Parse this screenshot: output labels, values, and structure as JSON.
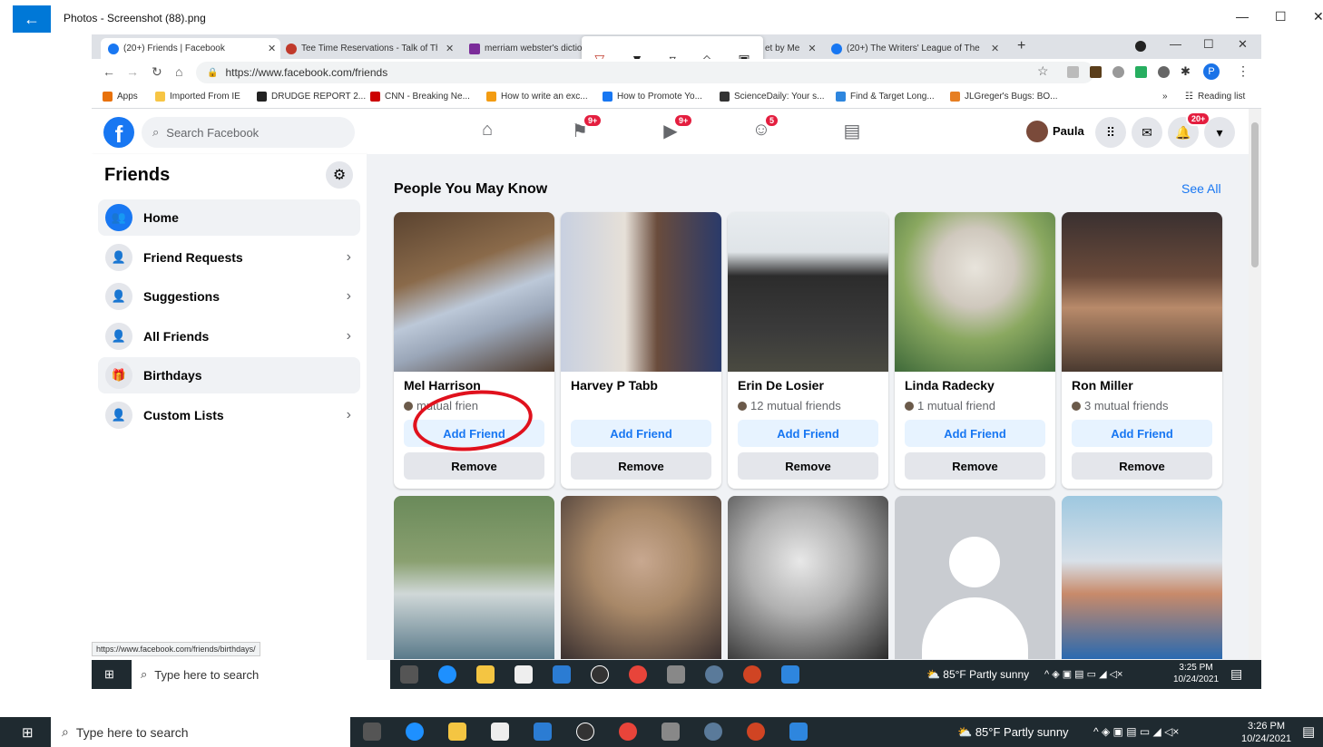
{
  "photos": {
    "title": "Photos - Screenshot (88).png",
    "back_icon": "←",
    "min": "—",
    "max": "☐",
    "close": "✕"
  },
  "tabs": [
    {
      "label": "(20+) Friends | Facebook",
      "color": "#1877f2"
    },
    {
      "label": "Tee Time Reservations - Talk of Th",
      "color": "#c0392b"
    },
    {
      "label": "merriam webster's dictio",
      "color": "#7b2c9a"
    },
    {
      "label": "et by Me",
      "color": "#999999"
    },
    {
      "label": "(20+) The Writers' League of The",
      "color": "#1877f2"
    }
  ],
  "address": {
    "url": "https://www.facebook.com/friends"
  },
  "bookmarks": [
    {
      "label": "Apps",
      "color": "#e8710a"
    },
    {
      "label": "Imported From IE",
      "color": "#f7c544"
    },
    {
      "label": "DRUDGE REPORT 2...",
      "color": "#222222"
    },
    {
      "label": "CNN - Breaking Ne...",
      "color": "#cc0000"
    },
    {
      "label": "How to write an exc...",
      "color": "#f39c12"
    },
    {
      "label": "How to Promote Yo...",
      "color": "#1877f2"
    },
    {
      "label": "ScienceDaily: Your s...",
      "color": "#333333"
    },
    {
      "label": "Find & Target Long...",
      "color": "#2e86de"
    },
    {
      "label": "JLGreger's Bugs: BO...",
      "color": "#e67e22"
    }
  ],
  "reading_list": "Reading list",
  "fb": {
    "logo": "f",
    "search_placeholder": "Search Facebook",
    "badges": {
      "pages": "9+",
      "watch": "9+",
      "groups": "5",
      "notifications": "20+"
    },
    "user": "Paula"
  },
  "sidebar": {
    "title": "Friends",
    "items": [
      {
        "label": "Home"
      },
      {
        "label": "Friend Requests"
      },
      {
        "label": "Suggestions"
      },
      {
        "label": "All Friends"
      },
      {
        "label": "Birthdays"
      },
      {
        "label": "Custom Lists"
      }
    ],
    "status_url": "https://www.facebook.com/friends/birthdays/"
  },
  "main": {
    "title": "People You May Know",
    "see_all": "See All",
    "add_label": "Add Friend",
    "remove_label": "Remove",
    "people": [
      {
        "name": "Mel Harrison",
        "mutual": "mutual frien"
      },
      {
        "name": "Harvey P Tabb",
        "mutual": ""
      },
      {
        "name": "Erin De Losier",
        "mutual": "12 mutual friends"
      },
      {
        "name": "Linda Radecky",
        "mutual": "1 mutual friend"
      },
      {
        "name": "Ron Miller",
        "mutual": "3 mutual friends"
      }
    ]
  },
  "taskbar_inner": {
    "search": "Type here to search",
    "weather": "85°F  Partly sunny",
    "time": "3:25 PM",
    "date": "10/24/2021"
  },
  "taskbar": {
    "search": "Type here to search",
    "weather": "85°F  Partly sunny",
    "time": "3:26 PM",
    "date": "10/24/2021"
  }
}
